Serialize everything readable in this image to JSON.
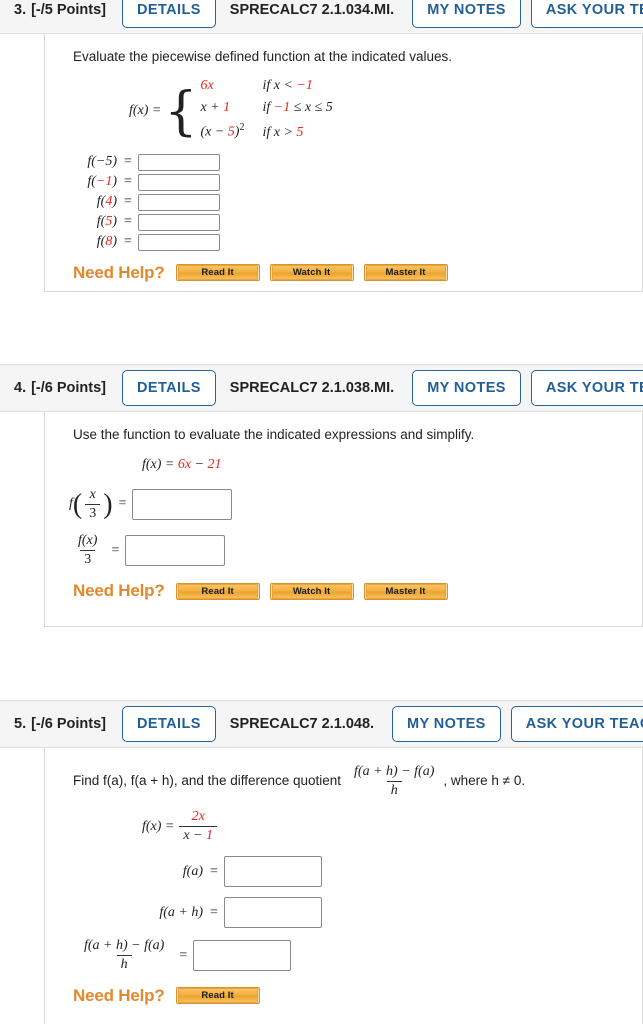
{
  "problems": [
    {
      "number": "3.",
      "points": "[-/5 Points]",
      "details_label": "DETAILS",
      "code": "SPRECALC7 2.1.034.MI.",
      "my_notes_label": "MY NOTES",
      "ask_label": "ASK YOUR TEACHER",
      "prompt": "Evaluate the piecewise defined function at the indicated values.",
      "function_label": "f(x) =",
      "pieces": [
        {
          "expr_black": "",
          "expr_red": "6x",
          "cond_pre": "if x < ",
          "cond_red": "−1",
          "cond_post": ""
        },
        {
          "expr_black": "x + ",
          "expr_red": "1",
          "cond_pre": "if ",
          "cond_red": "−1",
          "cond_post": " ≤ x ≤ 5"
        },
        {
          "expr_black": "(x − ",
          "expr_red": "5",
          "cond_pre": "if x > ",
          "cond_red": "5",
          "cond_post": ""
        }
      ],
      "answers": [
        {
          "label_pre": "f(",
          "label_red": "",
          "label_black": "−5",
          "label_post": ")",
          "value": ""
        },
        {
          "label_pre": "f(",
          "label_red": "−1",
          "label_black": "",
          "label_post": ")",
          "value": ""
        },
        {
          "label_pre": "f(",
          "label_red": "4",
          "label_black": "",
          "label_post": ")",
          "value": ""
        },
        {
          "label_pre": "f(",
          "label_red": "5",
          "label_black": "",
          "label_post": ")",
          "value": ""
        },
        {
          "label_pre": "f(",
          "label_red": "8",
          "label_black": "",
          "label_post": ")",
          "value": ""
        }
      ],
      "need_help_label": "Need Help?",
      "help_buttons": [
        "Read It",
        "Watch It",
        "Master It"
      ]
    },
    {
      "number": "4.",
      "points": "[-/6 Points]",
      "details_label": "DETAILS",
      "code": "SPRECALC7 2.1.038.MI.",
      "my_notes_label": "MY NOTES",
      "ask_label": "ASK YOUR TEACHER",
      "prompt": "Use the function to evaluate the indicated expressions and simplify.",
      "function_label": "f(x) =",
      "function_black": "x − ",
      "function_red_1": "6",
      "function_red_2": "21",
      "answers": [
        {
          "type": "fx_over_3_inside",
          "num": "x",
          "den": "3"
        },
        {
          "type": "fx_over_3_outside",
          "num": "f(x)",
          "den": "3"
        }
      ],
      "need_help_label": "Need Help?",
      "help_buttons": [
        "Read It",
        "Watch It",
        "Master It"
      ]
    },
    {
      "number": "5.",
      "points": "[-/6 Points]",
      "details_label": "DETAILS",
      "code": "SPRECALC7 2.1.048.",
      "my_notes_label": "MY NOTES",
      "ask_label": "ASK YOUR TEACHER",
      "prompt_part1": "Find  f(a), f(a + h),  and the difference quotient",
      "dq_num": "f(a + h) − f(a)",
      "dq_den": "h",
      "prompt_part2": ",  where h ≠ 0.",
      "function_label": "f(x) =",
      "function_num_red": "2x",
      "function_den_black": "x − ",
      "function_den_red": "1",
      "answers": [
        {
          "label": "f(a)",
          "value": ""
        },
        {
          "label": "f(a + h)",
          "value": ""
        },
        {
          "type": "fraction",
          "num": "f(a + h) − f(a)",
          "den": "h",
          "value": ""
        }
      ],
      "need_help_label": "Need Help?",
      "help_buttons": [
        "Read It"
      ]
    }
  ]
}
